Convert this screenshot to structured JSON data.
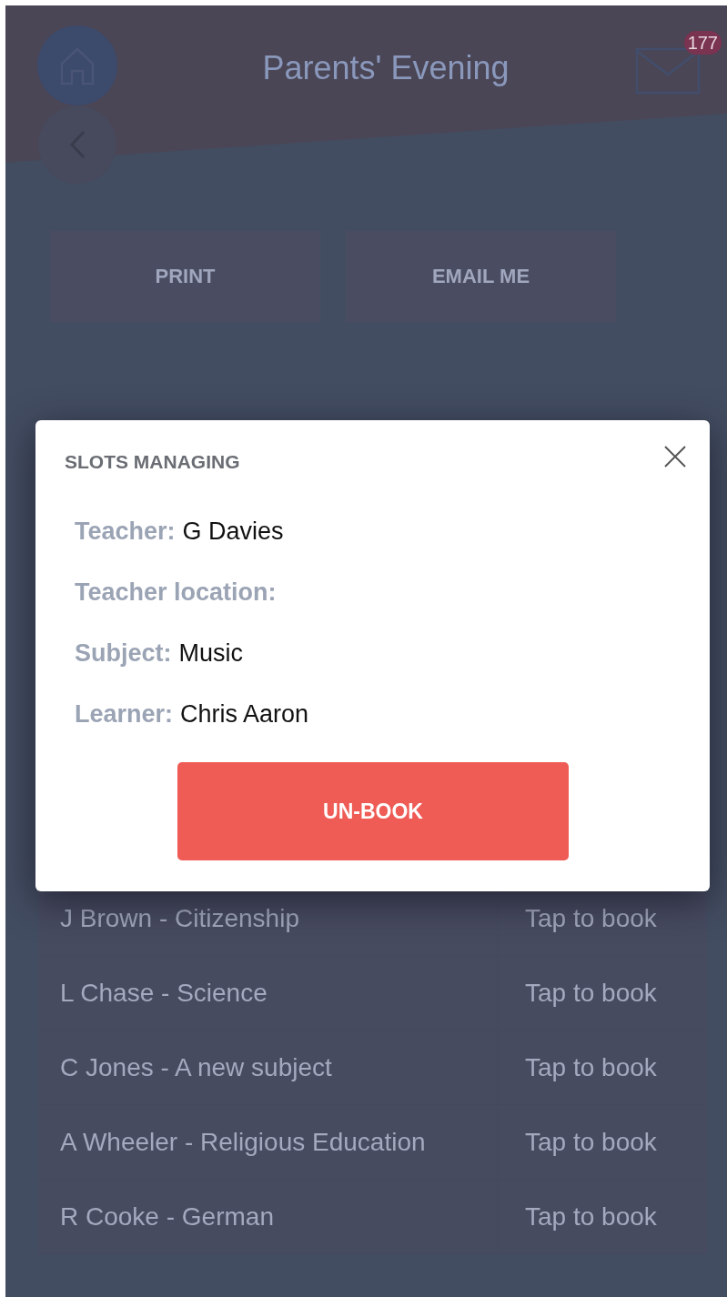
{
  "header": {
    "title": "Parents' Evening",
    "mail_badge": "177"
  },
  "actions": [
    "PRINT",
    "EMAIL ME"
  ],
  "slots": [
    {
      "teacher_subject": "J Brown - Citizenship",
      "action": "Tap to book"
    },
    {
      "teacher_subject": "L Chase - Science",
      "action": "Tap to book"
    },
    {
      "teacher_subject": "C Jones - A new subject",
      "action": "Tap to book"
    },
    {
      "teacher_subject": "A Wheeler - Religious Education",
      "action": "Tap to book"
    },
    {
      "teacher_subject": "R Cooke - German",
      "action": "Tap to book"
    }
  ],
  "dialog": {
    "title": "SLOTS MANAGING",
    "fields": [
      {
        "label": "Teacher:",
        "value": "G Davies"
      },
      {
        "label": "Teacher location:"
      },
      {
        "label": "Subject:",
        "value": "Music"
      },
      {
        "label": "Learner:",
        "value": "Chris Aaron"
      }
    ],
    "button": "UN-BOOK"
  }
}
